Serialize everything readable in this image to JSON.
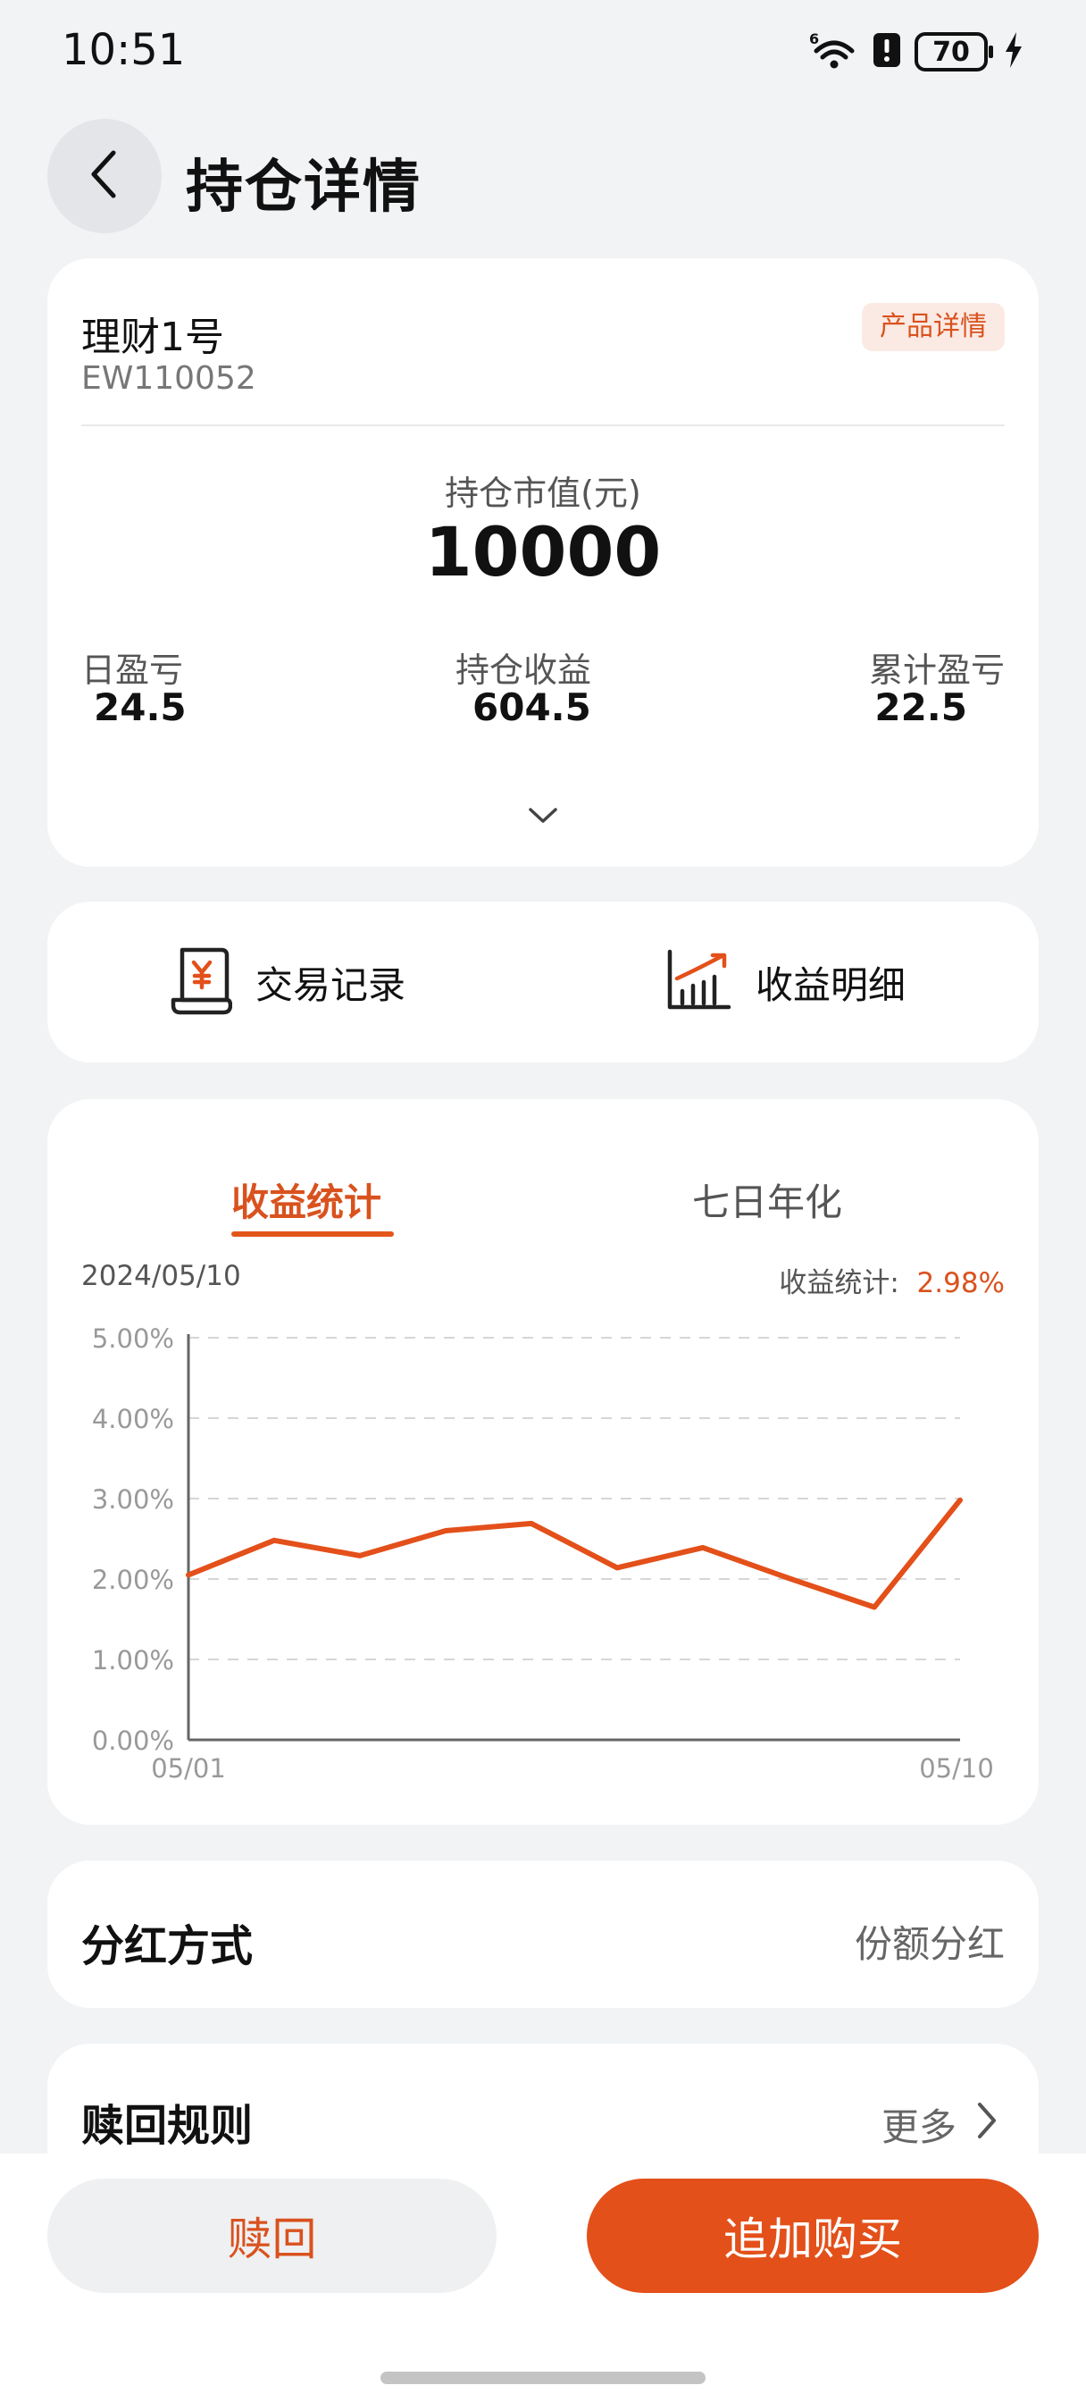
{
  "status_bar": {
    "time": "10:51",
    "battery": "70",
    "icons": [
      "wifi-6-icon",
      "alert-icon",
      "battery-icon",
      "charging-icon"
    ]
  },
  "header": {
    "title": "持仓详情",
    "back_icon": "chevron-left-icon"
  },
  "summary": {
    "product_name": "理财1号",
    "product_code": "EW110052",
    "detail_tag": "产品详情",
    "market_value_label": "持仓市值(元)",
    "market_value": "10000",
    "stats": [
      {
        "label": "日盈亏",
        "value": "24.5"
      },
      {
        "label": "持仓收益",
        "value": "604.5"
      },
      {
        "label": "累计盈亏",
        "value": "22.5"
      }
    ]
  },
  "links": {
    "records_label": "交易记录",
    "records_icon": "receipt-yen-icon",
    "income_label": "收益明细",
    "income_icon": "bar-chart-trend-icon"
  },
  "chart_section": {
    "tabs": [
      "收益统计",
      "七日年化"
    ],
    "active_tab": 0,
    "date": "2024/05/10",
    "stat_label": "收益统计:",
    "stat_value": "2.98%"
  },
  "chart_data": {
    "type": "line",
    "title": "",
    "xlabel": "",
    "ylabel": "",
    "ylim": [
      0,
      5
    ],
    "y_ticks": [
      "0.00%",
      "1.00%",
      "2.00%",
      "3.00%",
      "4.00%",
      "5.00%"
    ],
    "x_tick_labels": [
      "05/01",
      "05/10"
    ],
    "grid": true,
    "series": [
      {
        "color": "#e3501a",
        "values": [
          2.05,
          2.48,
          2.29,
          2.6,
          2.69,
          2.14,
          2.39,
          2.01,
          1.65,
          2.98
        ]
      }
    ]
  },
  "dividend": {
    "label": "分红方式",
    "value": "份额分红"
  },
  "redeem_rules": {
    "label": "赎回规则",
    "more": "更多"
  },
  "actions": {
    "redeem": "赎回",
    "buy_more": "追加购买"
  },
  "colors": {
    "accent": "#e3501a",
    "background": "#f1f3f5"
  }
}
